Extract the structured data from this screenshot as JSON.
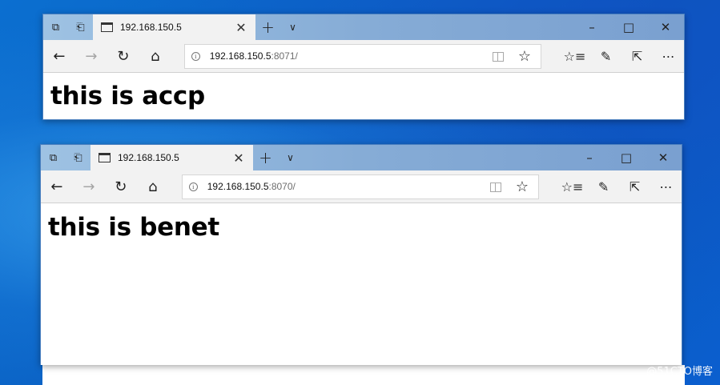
{
  "windows": [
    {
      "tab_title": "192.168.150.5",
      "url_host": "192.168.150.5",
      "url_rest": ":8071/",
      "heading": "this is accp"
    },
    {
      "tab_title": "192.168.150.5",
      "url_host": "192.168.150.5",
      "url_rest": ":8070/",
      "heading": "this is benet"
    }
  ],
  "icons": {
    "set_aside_tabs": "tab-set-aside-icon",
    "tab_preview": "tab-preview-icon",
    "back": "back-arrow-icon",
    "forward": "forward-arrow-icon",
    "refresh": "refresh-icon",
    "home": "home-icon",
    "reading_view": "reading-view-icon",
    "favorite": "star-icon",
    "favorites_hub": "favorites-hub-icon",
    "notes": "pen-icon",
    "share": "share-icon",
    "more": "more-icon"
  },
  "watermark": "@51CTO博客",
  "colors": {
    "titlebar": "#8fb3dc",
    "desktop": "#0a63c6"
  }
}
